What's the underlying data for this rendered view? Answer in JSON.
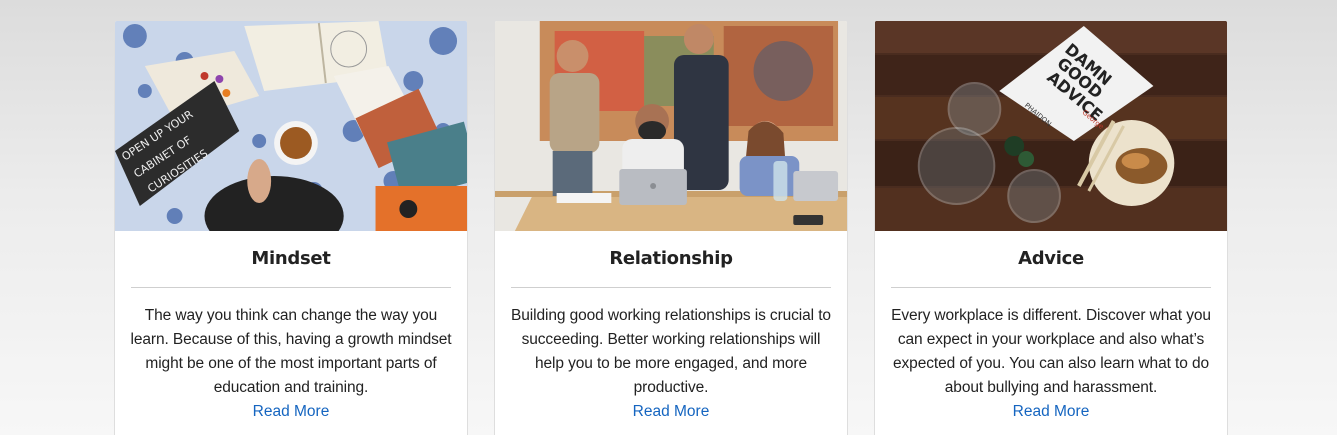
{
  "cards": [
    {
      "title": "Mindset",
      "text": "The way you think can change the way you learn. Because of this, having a growth mindset might be one of the most important parts of education and training.",
      "link": "Read More",
      "image": "study-table-photo",
      "image_text": [
        "OPEN UP YOUR",
        "CABINET OF",
        "CURIOSITIES"
      ]
    },
    {
      "title": "Relationship",
      "text": "Building good working relationships is crucial to succeeding. Better working relationships will help you to be more engaged, and more productive.",
      "link": "Read More",
      "image": "team-meeting-photo"
    },
    {
      "title": "Advice",
      "text": "Every workplace is different. Discover what you can expect in your workplace and also what’s expected of you. You can also learn what to do about bullying and harassment.",
      "link": "Read More",
      "image": "advice-book-photo",
      "image_text": [
        "DAMN",
        "GOOD",
        "ADVICE",
        "PHAIDON",
        "George Lois"
      ]
    }
  ],
  "colors": {
    "link": "#1565c0",
    "title": "#222222",
    "divider": "#cfcfcf"
  }
}
